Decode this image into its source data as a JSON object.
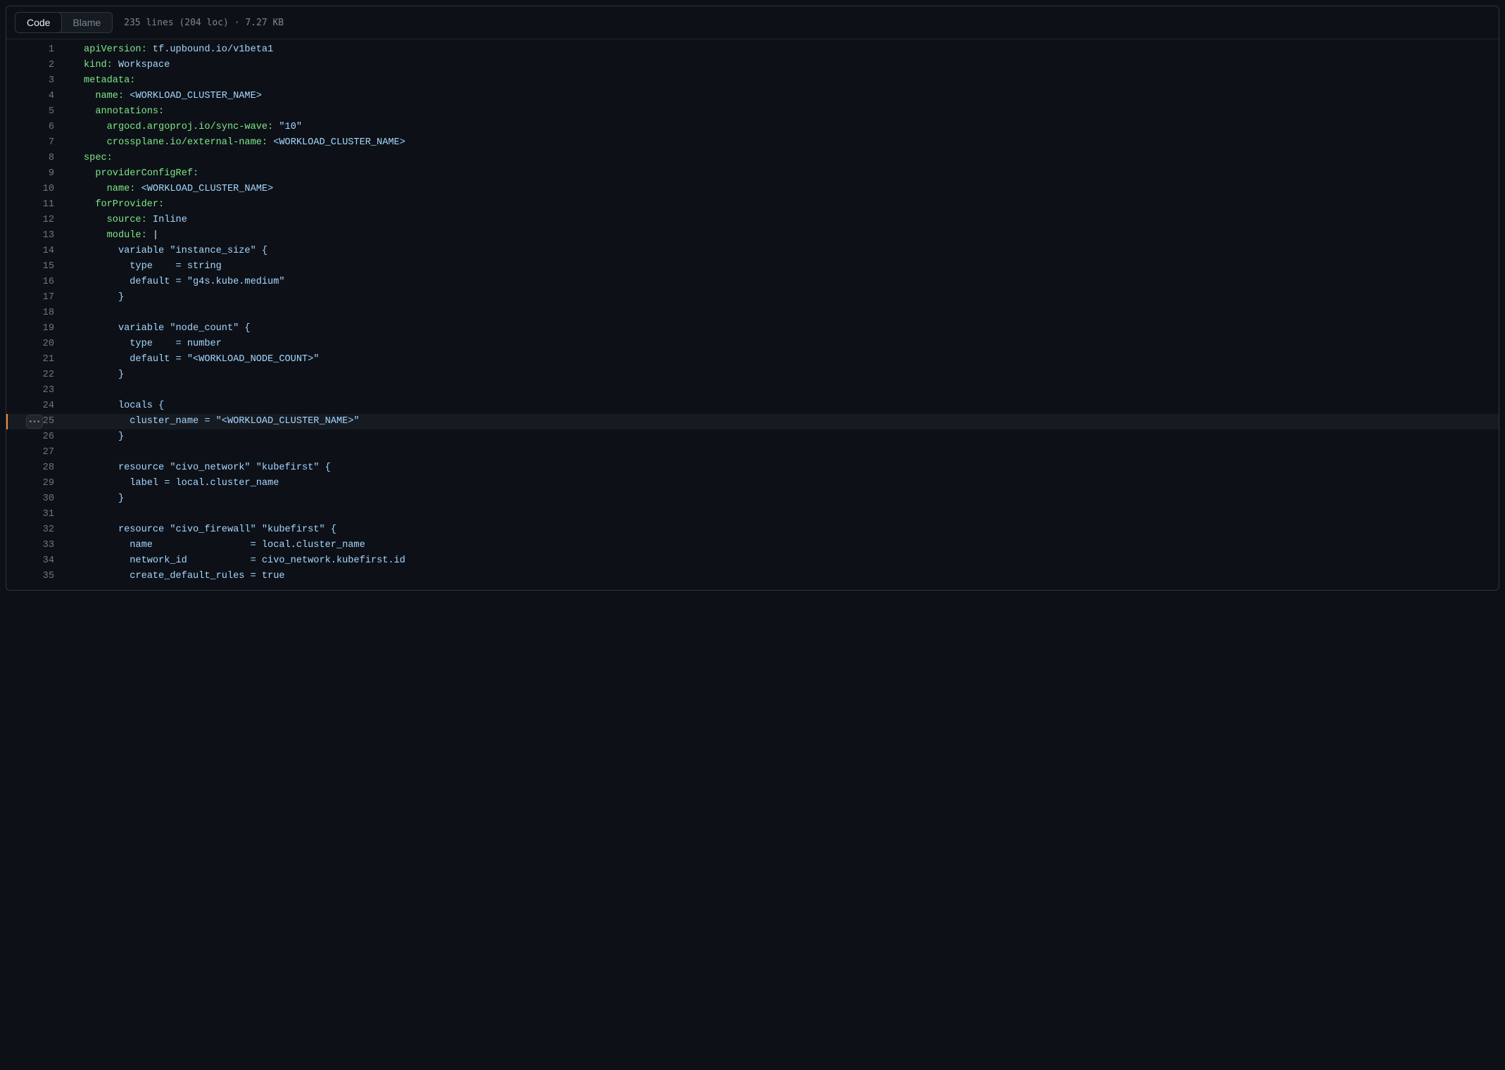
{
  "toolbar": {
    "code_label": "Code",
    "blame_label": "Blame",
    "file_info": "235 lines (204 loc) · 7.27 KB"
  },
  "highlight_line": 25,
  "code": {
    "lines": [
      {
        "n": 1,
        "indent": 0,
        "tokens": [
          [
            "k",
            "apiVersion: "
          ],
          [
            "s",
            "tf.upbound.io/v1beta1"
          ]
        ]
      },
      {
        "n": 2,
        "indent": 0,
        "tokens": [
          [
            "k",
            "kind: "
          ],
          [
            "s",
            "Workspace"
          ]
        ]
      },
      {
        "n": 3,
        "indent": 0,
        "tokens": [
          [
            "k",
            "metadata:"
          ]
        ]
      },
      {
        "n": 4,
        "indent": 1,
        "tokens": [
          [
            "k",
            "name: "
          ],
          [
            "s",
            "<WORKLOAD_CLUSTER_NAME>"
          ]
        ]
      },
      {
        "n": 5,
        "indent": 1,
        "tokens": [
          [
            "k",
            "annotations:"
          ]
        ]
      },
      {
        "n": 6,
        "indent": 2,
        "tokens": [
          [
            "k",
            "argocd.argoproj.io/sync-wave: "
          ],
          [
            "s",
            "\"10\""
          ]
        ]
      },
      {
        "n": 7,
        "indent": 2,
        "tokens": [
          [
            "k",
            "crossplane.io/external-name: "
          ],
          [
            "s",
            "<WORKLOAD_CLUSTER_NAME>"
          ]
        ]
      },
      {
        "n": 8,
        "indent": 0,
        "tokens": [
          [
            "k",
            "spec:"
          ]
        ]
      },
      {
        "n": 9,
        "indent": 1,
        "tokens": [
          [
            "k",
            "providerConfigRef:"
          ]
        ]
      },
      {
        "n": 10,
        "indent": 2,
        "tokens": [
          [
            "k",
            "name: "
          ],
          [
            "s",
            "<WORKLOAD_CLUSTER_NAME>"
          ]
        ]
      },
      {
        "n": 11,
        "indent": 1,
        "tokens": [
          [
            "k",
            "forProvider:"
          ]
        ]
      },
      {
        "n": 12,
        "indent": 2,
        "tokens": [
          [
            "k",
            "source: "
          ],
          [
            "s",
            "Inline"
          ]
        ]
      },
      {
        "n": 13,
        "indent": 2,
        "tokens": [
          [
            "k",
            "module: "
          ],
          [
            "p",
            "|"
          ]
        ]
      },
      {
        "n": 14,
        "indent": 3,
        "tokens": [
          [
            "s",
            "variable \"instance_size\" {"
          ]
        ]
      },
      {
        "n": 15,
        "indent": 3,
        "tokens": [
          [
            "s",
            "  type    = string"
          ]
        ]
      },
      {
        "n": 16,
        "indent": 3,
        "tokens": [
          [
            "s",
            "  default = \"g4s.kube.medium\""
          ]
        ]
      },
      {
        "n": 17,
        "indent": 3,
        "tokens": [
          [
            "s",
            "}"
          ]
        ]
      },
      {
        "n": 18,
        "indent": 3,
        "tokens": []
      },
      {
        "n": 19,
        "indent": 3,
        "tokens": [
          [
            "s",
            "variable \"node_count\" {"
          ]
        ]
      },
      {
        "n": 20,
        "indent": 3,
        "tokens": [
          [
            "s",
            "  type    = number"
          ]
        ]
      },
      {
        "n": 21,
        "indent": 3,
        "tokens": [
          [
            "s",
            "  default = \"<WORKLOAD_NODE_COUNT>\""
          ]
        ]
      },
      {
        "n": 22,
        "indent": 3,
        "tokens": [
          [
            "s",
            "}"
          ]
        ]
      },
      {
        "n": 23,
        "indent": 3,
        "tokens": []
      },
      {
        "n": 24,
        "indent": 3,
        "tokens": [
          [
            "s",
            "locals {"
          ]
        ]
      },
      {
        "n": 25,
        "indent": 3,
        "tokens": [
          [
            "s",
            "  cluster_name = \"<WORKLOAD_CLUSTER_NAME>\""
          ]
        ]
      },
      {
        "n": 26,
        "indent": 3,
        "tokens": [
          [
            "s",
            "}"
          ]
        ]
      },
      {
        "n": 27,
        "indent": 3,
        "tokens": []
      },
      {
        "n": 28,
        "indent": 3,
        "tokens": [
          [
            "s",
            "resource \"civo_network\" \"kubefirst\" {"
          ]
        ]
      },
      {
        "n": 29,
        "indent": 3,
        "tokens": [
          [
            "s",
            "  label = local.cluster_name"
          ]
        ]
      },
      {
        "n": 30,
        "indent": 3,
        "tokens": [
          [
            "s",
            "}"
          ]
        ]
      },
      {
        "n": 31,
        "indent": 3,
        "tokens": []
      },
      {
        "n": 32,
        "indent": 3,
        "tokens": [
          [
            "s",
            "resource \"civo_firewall\" \"kubefirst\" {"
          ]
        ]
      },
      {
        "n": 33,
        "indent": 3,
        "tokens": [
          [
            "s",
            "  name                 = local.cluster_name"
          ]
        ]
      },
      {
        "n": 34,
        "indent": 3,
        "tokens": [
          [
            "s",
            "  network_id           = civo_network.kubefirst.id"
          ]
        ]
      },
      {
        "n": 35,
        "indent": 3,
        "tokens": [
          [
            "s",
            "  create_default_rules = true"
          ]
        ]
      }
    ]
  }
}
